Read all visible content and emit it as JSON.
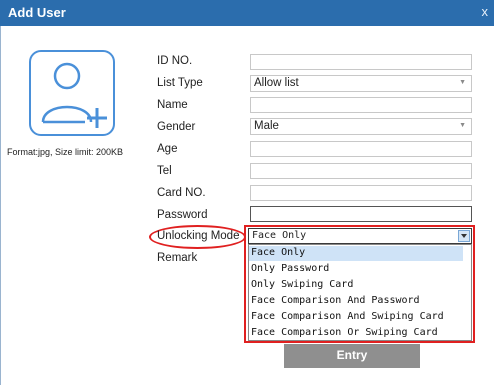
{
  "window": {
    "title": "Add User",
    "close_glyph": "x"
  },
  "photo": {
    "icon": "add-user-icon",
    "format_note": "Format:jpg, Size limit: 200KB"
  },
  "form": {
    "id_no_label": "ID NO.",
    "list_type_label": "List Type",
    "list_type_value": "Allow list",
    "name_label": "Name",
    "gender_label": "Gender",
    "gender_value": "Male",
    "age_label": "Age",
    "tel_label": "Tel",
    "card_no_label": "Card NO.",
    "password_label": "Password",
    "unlocking_mode_label": "Unlocking Mode",
    "unlocking_mode_value": "Face Only",
    "remark_label": "Remark"
  },
  "unlocking_options": [
    "Face Only",
    "Only Password",
    "Only Swiping Card",
    "Face Comparison And Password",
    "Face Comparison And Swiping Card",
    "Face Comparison Or Swiping Card"
  ],
  "entry_button": "Entry",
  "colors": {
    "titlebar": "#2b6dad",
    "highlight": "#e02020",
    "accent": "#4a90d9"
  }
}
